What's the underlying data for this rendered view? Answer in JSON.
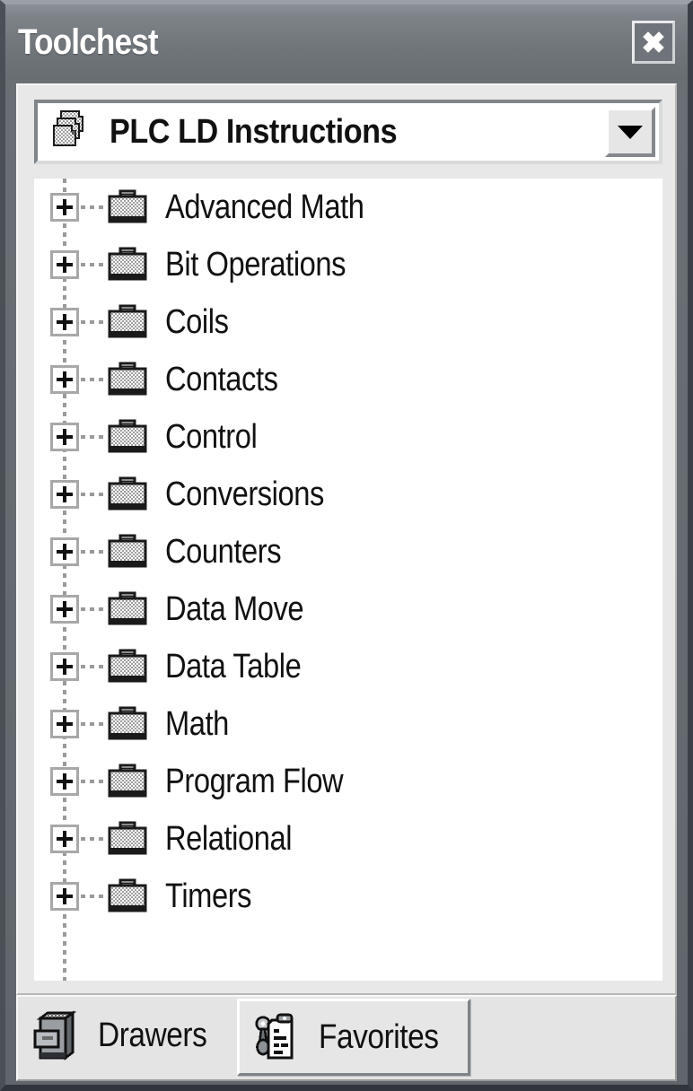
{
  "window": {
    "title": "Toolchest",
    "close_label": "✕"
  },
  "combo": {
    "selected": "PLC LD Instructions",
    "icon": "drawer-stack-icon",
    "arrow_icon": "chevron-down-icon"
  },
  "tree": {
    "expander_glyph": "+",
    "items": [
      {
        "label": "Advanced Math",
        "icon": "toolbox-icon",
        "expanded": false
      },
      {
        "label": "Bit Operations",
        "icon": "toolbox-icon",
        "expanded": false
      },
      {
        "label": "Coils",
        "icon": "toolbox-icon",
        "expanded": false
      },
      {
        "label": "Contacts",
        "icon": "toolbox-icon",
        "expanded": false
      },
      {
        "label": "Control",
        "icon": "toolbox-icon",
        "expanded": false
      },
      {
        "label": "Conversions",
        "icon": "toolbox-icon",
        "expanded": false
      },
      {
        "label": "Counters",
        "icon": "toolbox-icon",
        "expanded": false
      },
      {
        "label": "Data Move",
        "icon": "toolbox-icon",
        "expanded": false
      },
      {
        "label": "Data Table",
        "icon": "toolbox-icon",
        "expanded": false
      },
      {
        "label": "Math",
        "icon": "toolbox-icon",
        "expanded": false
      },
      {
        "label": "Program Flow",
        "icon": "toolbox-icon",
        "expanded": false
      },
      {
        "label": "Relational",
        "icon": "toolbox-icon",
        "expanded": false
      },
      {
        "label": "Timers",
        "icon": "toolbox-icon",
        "expanded": false
      }
    ]
  },
  "tabs": [
    {
      "label": "Drawers",
      "icon": "file-cabinet-icon",
      "selected": false
    },
    {
      "label": "Favorites",
      "icon": "clipboard-tools-icon",
      "selected": true
    }
  ],
  "colors": {
    "titlebar": "#70767b",
    "panel": "#e8e8e8",
    "tree_bg": "#ffffff",
    "text": "#111111",
    "title_text": "#ffffff",
    "line": "#9a9a9a"
  }
}
